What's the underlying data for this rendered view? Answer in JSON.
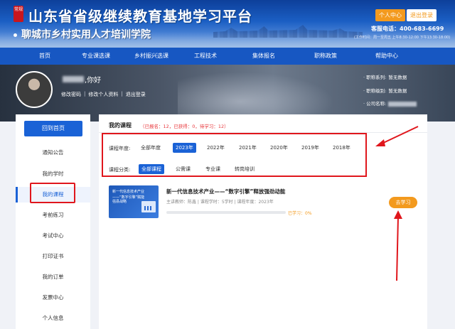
{
  "header": {
    "seal_text": "常规",
    "title": "山东省省级继续教育基地学习平台",
    "subtitle": "聊城市乡村实用人才培训学院",
    "personal_center": "个人中心",
    "exit_login": "退出登录",
    "hotline": "客服电话：400-683-6699",
    "work_time": "(工作时间：周一至周五 上午8:30-12:00 下午13:30-18:00)"
  },
  "nav": [
    "首页",
    "专业课选课",
    "乡村振兴选课",
    "工程技术",
    "集体报名",
    "职称政策",
    "帮助中心"
  ],
  "user": {
    "greeting": ",你好",
    "links": [
      "修改密码",
      "修改个人资料",
      "退出登录"
    ],
    "info": [
      {
        "label": "· 职称系列:",
        "value": "暂无数据"
      },
      {
        "label": "· 职称级别:",
        "value": "暂无数据"
      },
      {
        "label": "· 公司名称:",
        "value": ""
      }
    ]
  },
  "sidebar": {
    "home_button": "回到首页",
    "items": [
      "通知公告",
      "我的学时",
      "我的课程",
      "考前练习",
      "考试中心",
      "打印证书",
      "我的订单",
      "发票中心",
      "个人信息"
    ],
    "active": "我的课程"
  },
  "main": {
    "title": "我的课程",
    "stats": "（已报名：12，已获得：0，待学习：12）",
    "year_label": "课程年度:",
    "years": [
      "全部年度",
      "2023年",
      "2022年",
      "2021年",
      "2020年",
      "2019年",
      "2018年"
    ],
    "selected_year": "2023年",
    "category_label": "课程分类:",
    "categories": [
      "全部课程",
      "公需课",
      "专业课",
      "转岗培训"
    ],
    "selected_category": "全部课程"
  },
  "course": {
    "card_line1": "新一代信息技术产业",
    "card_line2": "——“数字引擎”赋能",
    "card_line3": "强县战略",
    "name": "新一代信息技术产业——“数字引擎”释放强劲动能",
    "meta": "主讲教师：陈鑫 | 课程学时：5学时 | 课程年度：2023年",
    "progress_percent": 0,
    "progress_text": "已学习：0%",
    "go_button": "去学习"
  },
  "colors": {
    "brand_blue": "#1a62d6",
    "accent_orange": "#f39a1e",
    "annotation_red": "#e0161c"
  }
}
